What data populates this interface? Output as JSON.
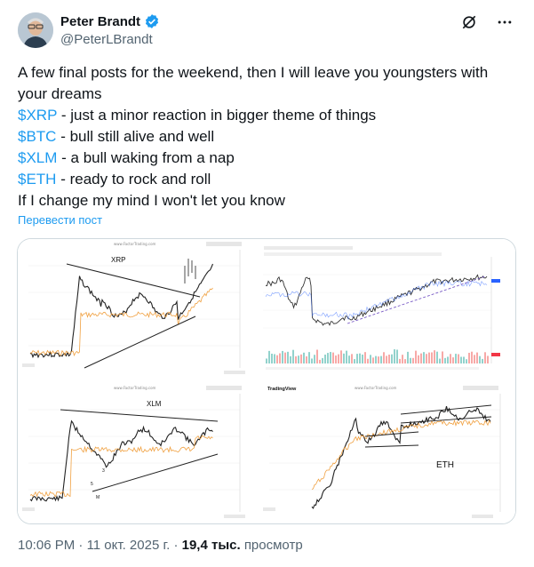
{
  "author": {
    "name": "Peter Brandt",
    "handle": "@PeterLBrandt"
  },
  "post": {
    "lines": [
      {
        "text": "A few final posts for the weekend, then I will leave you youngsters with your dreams"
      },
      {
        "tag": "$XRP",
        "text": " - just a minor reaction in bigger theme of things"
      },
      {
        "tag": "$BTC",
        "text": " - bull still alive and well"
      },
      {
        "tag": "$XLM",
        "text": " - a bull waking from a nap"
      },
      {
        "tag": "$ETH",
        "text": " - ready to rock and roll"
      },
      {
        "text": "If I change my mind I won't let you know"
      }
    ],
    "translate": "Перевести пост"
  },
  "media": {
    "charts": [
      {
        "label": "XRP",
        "source": "www.FactorTrading.com"
      },
      {
        "label": "",
        "source": "TradingView"
      },
      {
        "label": "XLM",
        "source": "www.FactorTrading.com"
      },
      {
        "label": "ETH",
        "source": "www.FactorTrading.com"
      }
    ],
    "tv_brand": "TradingView"
  },
  "meta": {
    "time": "10:06 PM",
    "date": "11 окт. 2025 г.",
    "views": "19,4 тыс.",
    "views_label": "просмотр"
  },
  "colors": {
    "cashtag": "#1d9bf0",
    "text": "#0f1419",
    "muted": "#536471",
    "verified": "#1d9bf0"
  },
  "icons": [
    "verified-badge-icon",
    "grok-icon",
    "more-icon"
  ]
}
